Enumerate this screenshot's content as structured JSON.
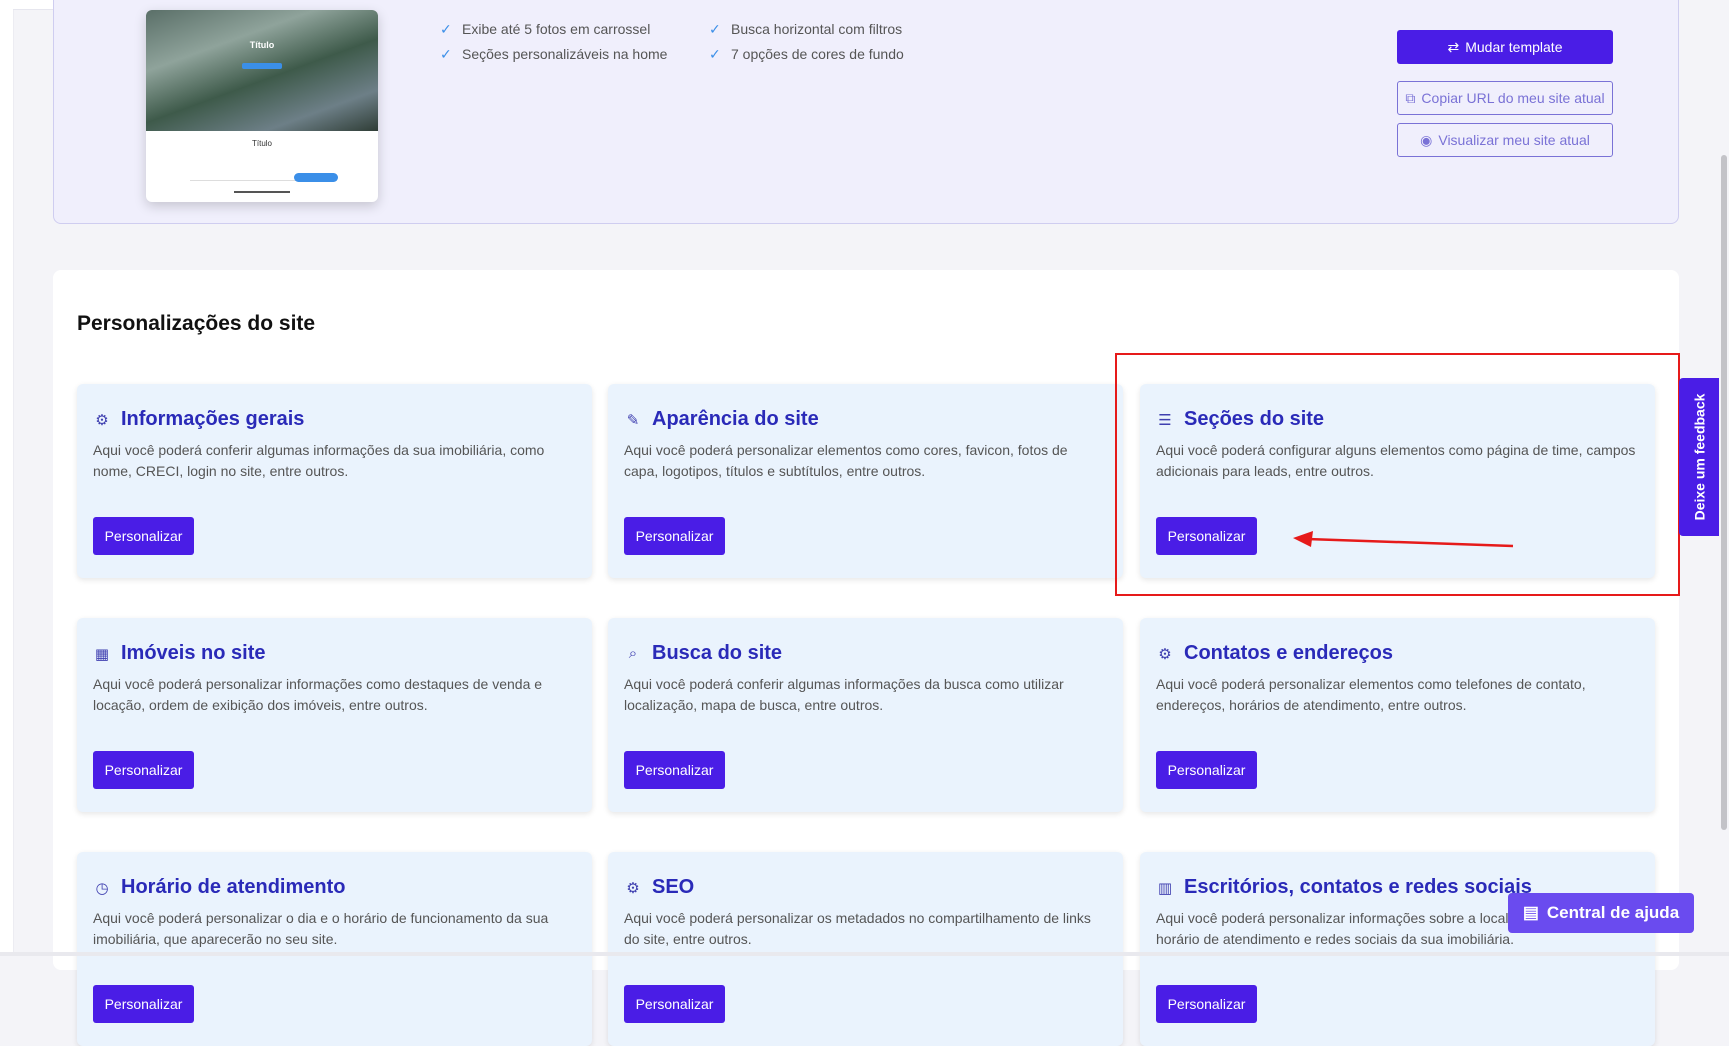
{
  "template_preview": {
    "hero_title": "Título",
    "body_title": "Título"
  },
  "features": {
    "col1": [
      "Exibe até 5 fotos em carrossel",
      "Seções personalizáveis na home"
    ],
    "col2": [
      "Busca horizontal com filtros",
      "7 opções de cores de fundo"
    ]
  },
  "actions": {
    "change_template": "Mudar template",
    "copy_url": "Copiar URL do meu site atual",
    "view_site": "Visualizar meu site atual"
  },
  "section_title": "Personalizações do site",
  "tiles": [
    {
      "title": "Informações gerais",
      "icon": "gear-icon",
      "desc": "Aqui você poderá conferir algumas informações da sua imobiliária, como nome, CRECI, login no site, entre outros.",
      "button": "Personalizar"
    },
    {
      "title": "Aparência do site",
      "icon": "brush-icon",
      "desc": "Aqui você poderá personalizar elementos como cores, favicon, fotos de capa, logotipos, títulos e subtítulos, entre outros.",
      "button": "Personalizar"
    },
    {
      "title": "Seções do site",
      "icon": "sections-icon",
      "desc": "Aqui você poderá configurar alguns elementos como página de time, campos adicionais para leads, entre outros.",
      "button": "Personalizar"
    },
    {
      "title": "Imóveis no site",
      "icon": "property-icon",
      "desc": "Aqui você poderá personalizar informações como destaques de venda e locação, ordem de exibição dos imóveis, entre outros.",
      "button": "Personalizar"
    },
    {
      "title": "Busca do site",
      "icon": "search-icon",
      "desc": "Aqui você poderá conferir algumas informações da busca como utilizar localização, mapa de busca, entre outros.",
      "button": "Personalizar"
    },
    {
      "title": "Contatos e endereços",
      "icon": "gear-icon",
      "desc": "Aqui você poderá personalizar elementos como telefones de contato, endereços, horários de atendimento, entre outros.",
      "button": "Personalizar"
    },
    {
      "title": "Horário de atendimento",
      "icon": "clock-icon",
      "desc": "Aqui você poderá personalizar o dia e o horário de funcionamento da sua imobiliária, que aparecerão no seu site.",
      "button": "Personalizar"
    },
    {
      "title": "SEO",
      "icon": "gear-icon",
      "desc": "Aqui você poderá personalizar os metadados no compartilhamento de links do site, entre outros.",
      "button": "Personalizar"
    },
    {
      "title": "Escritórios, contatos e redes sociais",
      "icon": "building-icon",
      "desc": "Aqui você poderá personalizar informações sobre a localização, contato, horário de atendimento e redes sociais da sua imobiliária.",
      "button": "Personalizar"
    }
  ],
  "feedback_tab": "Deixe um feedback",
  "help_button": "Central de ajuda",
  "colors": {
    "primary": "#4a1de6",
    "tile_bg": "#eaf3fd",
    "title_blue": "#2a2ab8",
    "highlight_red": "#e61a1a"
  }
}
